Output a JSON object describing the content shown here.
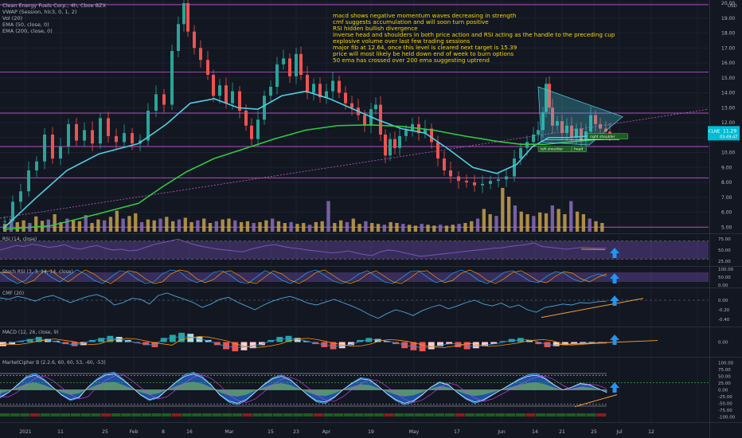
{
  "header": {
    "symbol_line": "Clean Energy Fuels Corp., 4h, Cboe BZX",
    "indicators": [
      "VWAP (Session, hlc3, 0, 1, 2)",
      "Vol (20)",
      "EMA (50, close, 0)",
      "EMA (200, close, 0)"
    ],
    "currency": "USD"
  },
  "annotations": [
    "macd shows negative momentum waves decreasing in strength",
    "cmf suggests accumulation and will soon turn positive",
    "RSI hidden bullish divergence",
    "inverse head and shoulders in both price action and RSI acting as the handle to the preceding cup",
    "explosive volume over last few trading sessions",
    "major fib at 12.64, once this level is cleared next target is 15.39",
    "price will most likely be held down end of week to burn options",
    "50 ema has crossed over 200 ema suggesting uptrend"
  ],
  "panes": {
    "rsi": "RSI (14, close)",
    "stoch": "Stoch RSI (3, 3, 14, 14, close)",
    "cmf": "CMF (20)",
    "macd": "MACD (12, 26, close, 9)",
    "cipher": "MarketCipher B (2.2.6, 60, 60, 53, -60, -53)"
  },
  "badges": {
    "price_ticker": "CLNE",
    "last_price": "11.29",
    "countdown": "03:49:47",
    "pattern_left": "left shoulder",
    "pattern_head": "head",
    "pattern_right": "right shoulder"
  },
  "colors": {
    "background": "#131722",
    "ema50": "#4dd0e1",
    "ema200": "#2ecc40",
    "annotation_text": "#f5d700",
    "volume": "#c8a24c",
    "level_line": "#b14fbf",
    "trend_line": "#f0a030",
    "arrow": "#2196f3"
  },
  "chart_data": [
    {
      "type": "line",
      "pane": "price",
      "title": "Clean Energy Fuels Corp., 4h, Cboe BZX",
      "x_ticks": [
        "2021",
        "11",
        "25",
        "Feb",
        "8",
        "16",
        "Mar",
        "15",
        "23",
        "Apr",
        "19",
        "May",
        "17",
        "Jun",
        "14",
        "21",
        "25",
        "Jul",
        "12"
      ],
      "y_ticks": [
        5.0,
        6.0,
        7.0,
        8.0,
        9.0,
        10.0,
        11.0,
        12.0,
        13.0,
        14.0,
        15.0,
        16.0,
        17.0,
        18.0,
        19.0,
        20.0
      ],
      "ylim": [
        4.8,
        20.0
      ],
      "price_path": [
        [
          0,
          5.4
        ],
        [
          10,
          6.7
        ],
        [
          20,
          7.4
        ],
        [
          30,
          8.8
        ],
        [
          40,
          9.4
        ],
        [
          50,
          11.2
        ],
        [
          60,
          9.6
        ],
        [
          70,
          10.4
        ],
        [
          80,
          11.9
        ],
        [
          90,
          10.8
        ],
        [
          100,
          11.5
        ],
        [
          110,
          10.6
        ],
        [
          120,
          12.3
        ],
        [
          130,
          11.1
        ],
        [
          140,
          10.7
        ],
        [
          150,
          11.3
        ],
        [
          160,
          10.6
        ],
        [
          170,
          10.8
        ],
        [
          180,
          12.8
        ],
        [
          190,
          13.9
        ],
        [
          200,
          13.2
        ],
        [
          210,
          16.8
        ],
        [
          218,
          18.6
        ],
        [
          225,
          20.0
        ],
        [
          230,
          18.1
        ],
        [
          238,
          17.0
        ],
        [
          246,
          16.2
        ],
        [
          255,
          15.2
        ],
        [
          262,
          13.8
        ],
        [
          270,
          14.5
        ],
        [
          278,
          13.3
        ],
        [
          286,
          14.1
        ],
        [
          295,
          12.8
        ],
        [
          303,
          11.8
        ],
        [
          310,
          10.9
        ],
        [
          318,
          12.2
        ],
        [
          326,
          13.8
        ],
        [
          334,
          14.4
        ],
        [
          342,
          15.9
        ],
        [
          350,
          16.3
        ],
        [
          358,
          15.1
        ],
        [
          366,
          16.6
        ],
        [
          372,
          15.2
        ],
        [
          380,
          14.0
        ],
        [
          388,
          14.6
        ],
        [
          396,
          13.7
        ],
        [
          404,
          14.1
        ],
        [
          412,
          14.8
        ],
        [
          420,
          14.0
        ],
        [
          428,
          13.3
        ],
        [
          436,
          13.0
        ],
        [
          444,
          12.5
        ],
        [
          452,
          11.8
        ],
        [
          460,
          12.9
        ],
        [
          466,
          13.2
        ],
        [
          472,
          11.2
        ],
        [
          478,
          9.8
        ],
        [
          484,
          10.9
        ],
        [
          490,
          10.3
        ],
        [
          496,
          11.1
        ],
        [
          504,
          11.5
        ],
        [
          512,
          11.9
        ],
        [
          520,
          11.3
        ],
        [
          528,
          11.6
        ],
        [
          536,
          10.7
        ],
        [
          544,
          9.6
        ],
        [
          552,
          8.8
        ],
        [
          560,
          8.4
        ],
        [
          570,
          8.1
        ],
        [
          580,
          8.0
        ],
        [
          590,
          7.8
        ],
        [
          600,
          7.9
        ],
        [
          610,
          8.1
        ],
        [
          620,
          8.2
        ],
        [
          630,
          8.4
        ],
        [
          640,
          9.6
        ],
        [
          648,
          10.3
        ],
        [
          656,
          10.7
        ],
        [
          664,
          11.2
        ],
        [
          670,
          11.5
        ],
        [
          676,
          12.7
        ],
        [
          680,
          14.6
        ],
        [
          684,
          13.0
        ],
        [
          688,
          11.8
        ],
        [
          694,
          12.1
        ],
        [
          700,
          11.3
        ],
        [
          706,
          11.8
        ],
        [
          712,
          11.0
        ],
        [
          718,
          11.6
        ],
        [
          724,
          10.8
        ],
        [
          730,
          11.4
        ],
        [
          736,
          12.5
        ],
        [
          742,
          11.9
        ],
        [
          748,
          11.6
        ],
        [
          755,
          11.4
        ],
        [
          760,
          11.29
        ]
      ],
      "series": [
        {
          "name": "EMA (50, close, 0)",
          "points": [
            [
              0,
              4.9
            ],
            [
              40,
              6.9
            ],
            [
              80,
              8.8
            ],
            [
              120,
              9.9
            ],
            [
              170,
              10.6
            ],
            [
              205,
              11.9
            ],
            [
              235,
              13.3
            ],
            [
              265,
              13.6
            ],
            [
              295,
              13.0
            ],
            [
              320,
              12.9
            ],
            [
              350,
              13.8
            ],
            [
              380,
              14.1
            ],
            [
              410,
              13.6
            ],
            [
              440,
              12.9
            ],
            [
              470,
              12.2
            ],
            [
              500,
              11.6
            ],
            [
              530,
              11.3
            ],
            [
              560,
              10.2
            ],
            [
              590,
              9.0
            ],
            [
              620,
              8.6
            ],
            [
              645,
              9.2
            ],
            [
              665,
              10.4
            ],
            [
              685,
              11.0
            ],
            [
              710,
              11.0
            ],
            [
              735,
              11.1
            ],
            [
              760,
              11.2
            ]
          ]
        },
        {
          "name": "EMA (200, close, 0)",
          "points": [
            [
              0,
              4.85
            ],
            [
              60,
              5.1
            ],
            [
              120,
              5.9
            ],
            [
              170,
              6.6
            ],
            [
              200,
              7.7
            ],
            [
              230,
              8.7
            ],
            [
              265,
              9.6
            ],
            [
              300,
              10.2
            ],
            [
              340,
              10.9
            ],
            [
              380,
              11.5
            ],
            [
              420,
              11.8
            ],
            [
              460,
              11.85
            ],
            [
              500,
              11.75
            ],
            [
              540,
              11.5
            ],
            [
              580,
              11.1
            ],
            [
              620,
              10.75
            ],
            [
              650,
              10.55
            ],
            [
              680,
              10.55
            ],
            [
              720,
              10.75
            ],
            [
              760,
              10.95
            ]
          ]
        }
      ],
      "levels": [
        5.0,
        8.3,
        10.4,
        12.64,
        15.39,
        19.9
      ],
      "volume": [
        18,
        30,
        22,
        26,
        20,
        35,
        25,
        28,
        40,
        22,
        30,
        26,
        24,
        38,
        20,
        28,
        26,
        34,
        48,
        30,
        36,
        42,
        22,
        28,
        26,
        30,
        34,
        24,
        28,
        32,
        22,
        26,
        30,
        20,
        24,
        28,
        30,
        26,
        22,
        24,
        20,
        22,
        26,
        30,
        24,
        20,
        22,
        18,
        20,
        16,
        22,
        24,
        70,
        20,
        26,
        22,
        30,
        18,
        24,
        20,
        18,
        16,
        22,
        20,
        18,
        16,
        14,
        18,
        16,
        14,
        16,
        14,
        16,
        18,
        20,
        24,
        30,
        52,
        40,
        36,
        100,
        80,
        60,
        46,
        40,
        36,
        44,
        42,
        60,
        52,
        40,
        70,
        46,
        40,
        30,
        24,
        20
      ]
    },
    {
      "type": "line",
      "pane": "rsi",
      "title": "RSI (14, close)",
      "y_ticks": [
        75.0,
        50.0,
        25.0
      ],
      "ylim": [
        20,
        80
      ],
      "values": [
        50,
        55,
        60,
        58,
        63,
        60,
        56,
        58,
        62,
        55,
        52,
        57,
        60,
        54,
        50,
        52,
        48,
        50,
        56,
        62,
        66,
        70,
        74,
        68,
        62,
        58,
        55,
        52,
        50,
        48,
        46,
        52,
        56,
        60,
        62,
        58,
        55,
        53,
        50,
        48,
        46,
        44,
        45,
        48,
        44,
        40,
        38,
        46,
        50,
        48,
        44,
        40,
        36,
        38,
        40,
        42,
        44,
        46,
        48,
        50,
        52,
        54,
        55,
        58,
        60,
        62,
        66,
        58,
        56,
        54,
        52,
        54,
        56,
        55,
        54,
        54
      ]
    },
    {
      "type": "line",
      "pane": "stoch",
      "title": "Stoch RSI (3, 3, 14, 14, close)",
      "y_ticks": [
        100.0,
        50.0,
        0.0
      ],
      "ylim": [
        0,
        100
      ],
      "values": [
        80,
        40,
        10,
        30,
        85,
        90,
        50,
        20,
        60,
        95,
        70,
        30,
        10,
        50,
        90,
        80,
        40,
        10,
        20,
        70,
        95,
        85,
        40,
        15,
        35,
        80,
        90,
        60,
        20,
        10,
        50,
        90,
        70,
        30,
        10,
        40,
        80,
        95,
        60,
        25,
        10,
        30,
        70,
        90,
        55,
        20,
        10,
        45,
        85,
        90,
        50,
        15,
        30,
        75,
        95,
        70,
        30,
        10,
        40,
        80,
        90,
        60,
        25,
        15,
        55,
        85,
        75,
        40,
        20,
        50,
        70,
        55
      ]
    },
    {
      "type": "line",
      "pane": "cmf",
      "title": "CMF (20)",
      "y_ticks": [
        0.0,
        -0.2,
        -0.4
      ],
      "ylim": [
        -0.5,
        0.2
      ],
      "values": [
        0.05,
        0.02,
        0.08,
        0.04,
        -0.02,
        0.06,
        0.1,
        0.03,
        -0.05,
        0.02,
        0.08,
        0.12,
        0.05,
        -0.1,
        -0.05,
        0.04,
        0.02,
        -0.08,
        0.1,
        0.15,
        0.08,
        0.02,
        -0.05,
        -0.15,
        -0.08,
        0.02,
        0.06,
        -0.04,
        -0.12,
        -0.2,
        -0.1,
        -0.02,
        0.04,
        0.08,
        0.02,
        -0.06,
        -0.1,
        -0.04,
        0.02,
        -0.05,
        -0.12,
        -0.2,
        -0.3,
        -0.38,
        -0.28,
        -0.2,
        -0.25,
        -0.32,
        -0.22,
        -0.15,
        -0.1,
        -0.18,
        -0.12,
        -0.05,
        0.0,
        -0.08,
        -0.12,
        -0.06,
        -0.15,
        -0.1,
        -0.2,
        -0.25,
        -0.15,
        -0.12,
        -0.08,
        -0.1,
        -0.05,
        -0.06,
        -0.03,
        -0.02
      ]
    },
    {
      "type": "bar",
      "pane": "macd",
      "title": "MACD (12, 26, close, 9)",
      "y_ticks": [
        0.0
      ],
      "ylim": [
        -1.2,
        1.2
      ],
      "values": [
        -0.4,
        -0.2,
        0.1,
        0.3,
        0.5,
        0.3,
        0.1,
        -0.2,
        -0.4,
        -0.3,
        0.2,
        0.4,
        0.6,
        0.5,
        0.2,
        -0.1,
        -0.3,
        -0.5,
        0.4,
        0.7,
        0.9,
        0.8,
        0.5,
        0.2,
        -0.3,
        -0.7,
        -0.9,
        -0.8,
        -0.6,
        -0.3,
        0.2,
        0.5,
        0.6,
        0.4,
        0.1,
        -0.2,
        -0.5,
        -0.7,
        -0.6,
        -0.3,
        0.2,
        0.4,
        0.3,
        0.1,
        -0.2,
        -0.6,
        -0.8,
        -0.9,
        -0.7,
        -0.4,
        -0.2,
        -0.5,
        -0.7,
        -0.6,
        -0.4,
        -0.2,
        0.1,
        0.3,
        0.4,
        0.2,
        -0.2,
        -0.5,
        -0.4,
        -0.3,
        -0.2,
        -0.15,
        -0.1,
        -0.05
      ]
    },
    {
      "type": "area",
      "pane": "cipher",
      "title": "MarketCipher B (2.2.6, 60, 60, 53, -60, -53)",
      "y_ticks": [
        100.0,
        75.0,
        50.0,
        25.0,
        0.0,
        -25.0,
        -50.0,
        -75.0,
        -100.0
      ],
      "ylim": [
        -110,
        110
      ],
      "values": [
        -30,
        -10,
        20,
        50,
        60,
        40,
        10,
        -20,
        -40,
        -30,
        10,
        40,
        60,
        65,
        40,
        10,
        -20,
        -40,
        -30,
        0,
        30,
        55,
        65,
        50,
        20,
        -20,
        -45,
        -55,
        -40,
        -10,
        20,
        45,
        55,
        40,
        10,
        -20,
        -45,
        -50,
        -30,
        0,
        25,
        45,
        40,
        15,
        -15,
        -40,
        -55,
        -45,
        -20,
        10,
        30,
        20,
        -10,
        -35,
        -50,
        -40,
        -20,
        0,
        20,
        40,
        55,
        60,
        45,
        20,
        0,
        10,
        25,
        20,
        5,
        -10
      ]
    }
  ]
}
